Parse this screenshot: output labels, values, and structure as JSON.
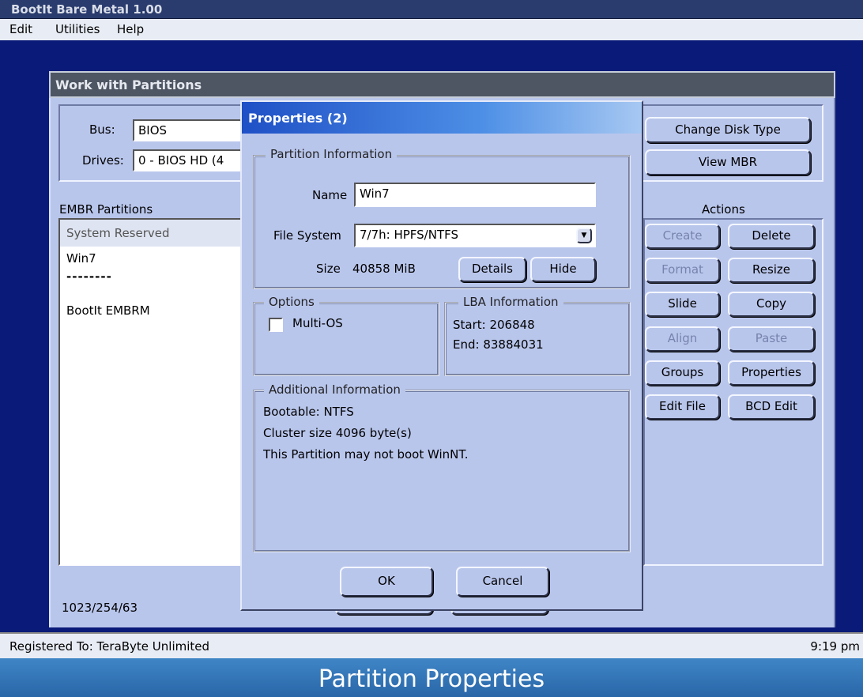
{
  "app": {
    "title": "BootIt Bare Metal 1.00"
  },
  "menu": {
    "edit": "Edit",
    "utilities": "Utilities",
    "help": "Help"
  },
  "main": {
    "title": "Work with Partitions",
    "bus_label": "Bus:",
    "bus_value": "BIOS",
    "drives_label": "Drives:",
    "drives_value": "0 - BIOS HD (4",
    "change_disk_type": "Change Disk Type",
    "view_mbr": "View MBR",
    "partitions_label": "EMBR Partitions",
    "partitions": [
      "System Reserved",
      "Win7",
      "--------",
      "BootIt EMBRM"
    ],
    "geometry": "1023/254/63",
    "actions_label": "Actions",
    "actions": {
      "create": "Create",
      "delete": "Delete",
      "format": "Format",
      "resize": "Resize",
      "slide": "Slide",
      "copy": "Copy",
      "align": "Align",
      "paste": "Paste",
      "groups": "Groups",
      "properties": "Properties",
      "edit_file": "Edit File",
      "bcd_edit": "BCD Edit"
    }
  },
  "dialog": {
    "title": "Properties (2)",
    "partition_info_label": "Partition Information",
    "name_label": "Name",
    "name_value": "Win7",
    "fs_label": "File System",
    "fs_value": "7/7h: HPFS/NTFS",
    "size_label": "Size",
    "size_value": "40858 MiB",
    "details": "Details",
    "hide": "Hide",
    "options_label": "Options",
    "multi_os": "Multi-OS",
    "lba_label": "LBA Information",
    "lba_start": "Start: 206848",
    "lba_end": "End: 83884031",
    "additional_label": "Additional Information",
    "additional_lines": [
      "Bootable: NTFS",
      "Cluster size 4096 byte(s)",
      "This Partition may not boot WinNT."
    ],
    "ok": "OK",
    "cancel": "Cancel"
  },
  "status": {
    "registered": "Registered To: TeraByte Unlimited",
    "time": "9:19 pm"
  },
  "caption": "Partition Properties",
  "colors": {
    "desktop": "#0a1a78",
    "window": "#b9c6ec",
    "caption": "#2966a8"
  }
}
